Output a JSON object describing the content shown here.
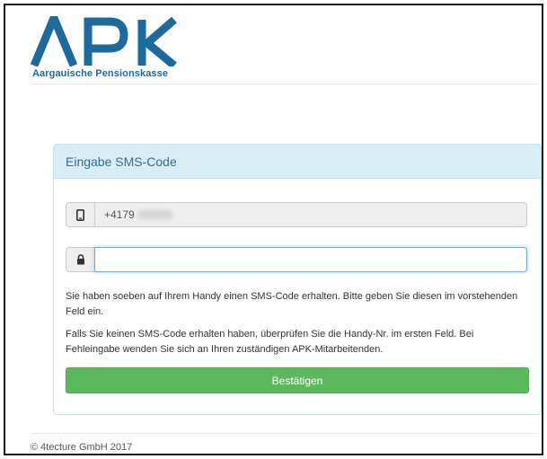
{
  "header": {
    "logo_text": "APK",
    "tagline": "Aargauische Pensionskasse",
    "brand_color": "#1d6a9c"
  },
  "panel": {
    "title": "Eingabe SMS-Code",
    "phone": {
      "icon": "mobile-phone-icon",
      "value": "+4179"
    },
    "code": {
      "icon": "lock-icon",
      "value": ""
    },
    "instruction_1": "Sie haben soeben auf Ihrem Handy einen SMS-Code erhalten. Bitte geben Sie diesen im vorstehenden Feld ein.",
    "instruction_2": "Falls Sie keinen SMS-Code erhalten haben, überprüfen Sie die Handy-Nr. im ersten Feld. Bei Fehleingabe wenden Sie sich an Ihren zuständigen APK-Mitarbeitenden.",
    "confirm_label": "Bestätigen",
    "confirm_color": "#5cb85c"
  },
  "footer": {
    "copyright": "© 4tecture GmbH 2017"
  }
}
